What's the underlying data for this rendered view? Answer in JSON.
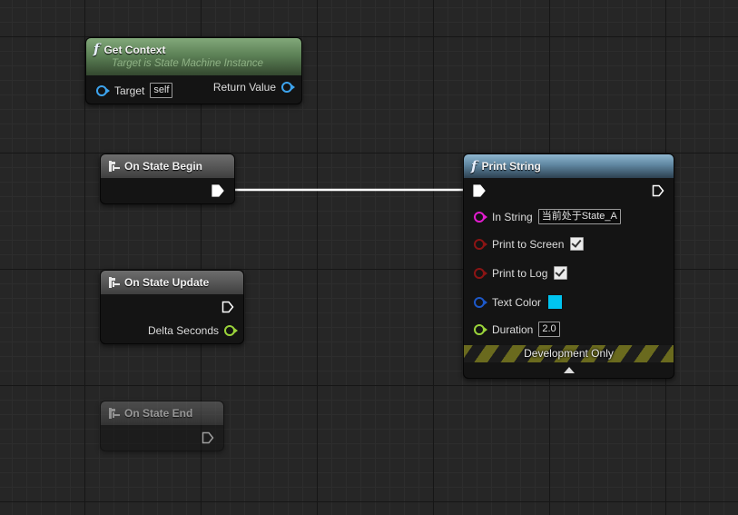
{
  "nodes": {
    "get_context": {
      "title": "Get Context",
      "subtitle": "Target is State Machine Instance",
      "target_label": "Target",
      "target_value": "self",
      "return_label": "Return Value"
    },
    "on_state_begin": {
      "title": "On State Begin"
    },
    "on_state_update": {
      "title": "On State Update",
      "delta_label": "Delta Seconds"
    },
    "on_state_end": {
      "title": "On State End"
    },
    "print_string": {
      "title": "Print String",
      "in_string_label": "In String",
      "in_string_value": "当前处于State_A",
      "print_to_screen_label": "Print to Screen",
      "print_to_screen": true,
      "print_to_log_label": "Print to Log",
      "print_to_log": true,
      "text_color_label": "Text Color",
      "text_color": "#00c4f0",
      "duration_label": "Duration",
      "duration_value": "2.0",
      "dev_only_label": "Development Only"
    }
  },
  "icons": {
    "function": "function-f-icon",
    "event": "event-icon",
    "exec": "exec-pin-icon",
    "collapse": "collapse-arrow-icon"
  },
  "colors": {
    "function_header": "#5d8257",
    "print_header": "#5f86a0",
    "object_pin": "#3da4ee",
    "float_pin": "#9ad33a",
    "string_pin": "#e21ccf",
    "bool_pin": "#8b1414",
    "color_pin": "#1d58c8",
    "wire": "#ffffff"
  }
}
